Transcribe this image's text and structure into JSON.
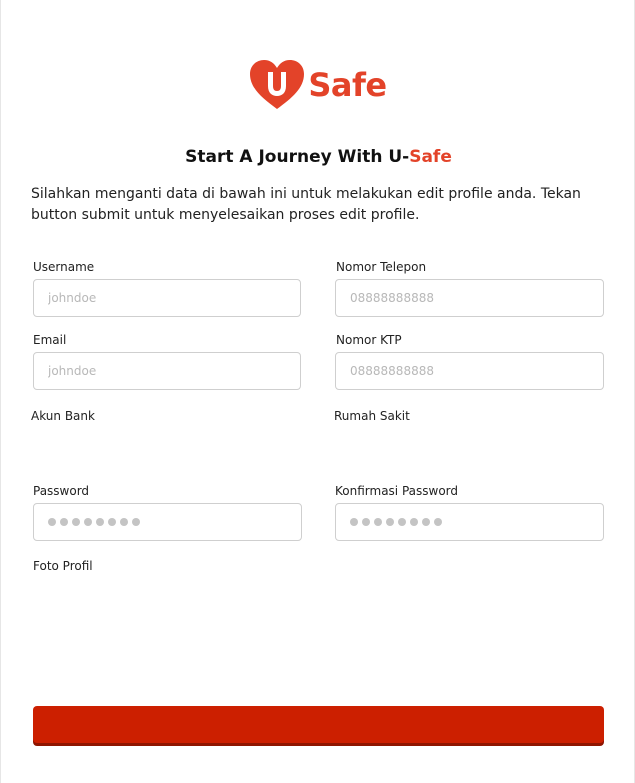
{
  "brand": {
    "name": "Safe",
    "accent_color": "#e34329"
  },
  "header": {
    "title_prefix": "Start A Journey With U-",
    "title_accent": "Safe",
    "description": "Silahkan menganti data di bawah ini untuk melakukan edit profile anda. Tekan button submit untuk menyelesaikan proses edit profile."
  },
  "form": {
    "username": {
      "label": "Username",
      "placeholder": "johndoe"
    },
    "phone": {
      "label": "Nomor Telepon",
      "placeholder": "08888888888"
    },
    "email": {
      "label": "Email",
      "placeholder": "johndoe"
    },
    "ktp": {
      "label": "Nomor KTP",
      "placeholder": "08888888888"
    },
    "bank": {
      "label": "Akun Bank"
    },
    "hospital": {
      "label": "Rumah Sakit"
    },
    "password": {
      "label": "Password",
      "icon": "password-dots"
    },
    "confirm_password": {
      "label": "Konfirmasi Password",
      "icon": "password-dots"
    },
    "photo": {
      "label": "Foto Profil"
    },
    "submit_label": "",
    "submit_color": "#cc1f00"
  }
}
